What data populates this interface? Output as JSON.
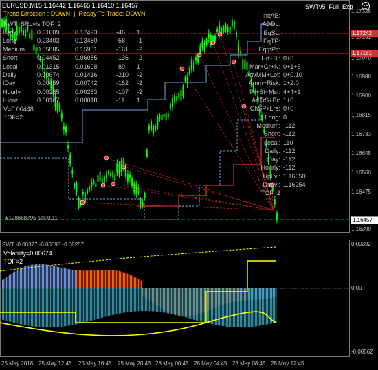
{
  "chart_header": {
    "symbol": "EURUSD,M15",
    "ohlc": "1.16442 1.16465 1.16410 1.16457",
    "expert_name": "SWTv5_Full_Exp",
    "smiley_icon": "smiley-icon"
  },
  "trend_status": {
    "text": "Trend Direction : DOWN  |  Ready To Trade: DOWN",
    "color": "#ffd700"
  },
  "indicator_table": {
    "title": "SWT_SRLvls TOF=2",
    "rows": [
      {
        "label": "Basic",
        "v1": "0.31009",
        "v2": "0.17493",
        "v3": "-46",
        "v4": "1"
      },
      {
        "label": "Long",
        "v1": "0.23403",
        "v2": "0.13480",
        "v3": "-58",
        "v4": "-1"
      },
      {
        "label": "Medium",
        "v1": "0.05885",
        "v2": "0.15951",
        "v3": "-161",
        "v4": "-2"
      },
      {
        "label": "Short",
        "v1": "0.04452",
        "v2": "0.06085",
        "v3": "-136",
        "v4": "-2"
      },
      {
        "label": "Local",
        "v1": "0.01315",
        "v2": "0.01608",
        "v3": "-89",
        "v4": "1"
      },
      {
        "label": "Daily",
        "v1": "0.00674",
        "v2": "0.01416",
        "v3": "-210",
        "v4": "-2"
      },
      {
        "label": "IDay",
        "v1": "0.00459",
        "v2": "0.00742",
        "v3": "-162",
        "v4": "-2"
      },
      {
        "label": "Hourly",
        "v1": "0.00285",
        "v2": "0.00283",
        "v3": "-107",
        "v4": "-2"
      },
      {
        "label": "IHour",
        "v1": "0.00107",
        "v2": "0.00018",
        "v3": "-11",
        "v4": "1"
      }
    ],
    "volatility_line": "V=0.00448",
    "tof_line": "TOF=2"
  },
  "status_panel": [
    {
      "label": "InitAB:",
      "value": ""
    },
    {
      "label": "ADDL:",
      "value": ""
    },
    {
      "label": "EqSL:",
      "value": ""
    },
    {
      "label": "EqTP:",
      "value": ""
    },
    {
      "label": "EqtpPc:",
      "value": ""
    },
    {
      "label": "Hrt+Bl:",
      "value": "0+0"
    },
    {
      "label": "Mar+Gr+N:",
      "value": "0+1+5"
    },
    {
      "label": "AdvMM+Lot:",
      "value": "0+0.10"
    },
    {
      "label": "Amm+Risk:",
      "value": "1+2.0"
    },
    {
      "label": "Pr+St+Mst:",
      "value": "4+4+1"
    },
    {
      "label": "AdTrS+Br:",
      "value": "1+0"
    },
    {
      "label": "ChSP+Lre:",
      "value": "0+0"
    },
    {
      "label": "Long:",
      "value": "0"
    },
    {
      "label": "Medium:",
      "value": "-112"
    },
    {
      "label": "Short:",
      "value": "-112"
    },
    {
      "label": "Local:",
      "value": "110"
    },
    {
      "label": "Daily:",
      "value": "-112"
    },
    {
      "label": "IDay:",
      "value": "-112"
    },
    {
      "label": "Hourly:",
      "value": "-112"
    },
    {
      "label": "UpLvl:",
      "value": "1.16650"
    },
    {
      "label": "DnLvl:",
      "value": "1.16254"
    },
    {
      "label": "TOF=2",
      "value": ""
    }
  ],
  "order_label": "#128688795 sell 0.11",
  "price_axis": {
    "labels": [
      "1.17325",
      "1.17161",
      "1.17070",
      "1.16988",
      "1.16900",
      "1.16815",
      "1.16733",
      "1.16645",
      "1.16560",
      "1.16475",
      "1.16390"
    ],
    "highlight_red_1": "1.17242",
    "highlight_red_2": "1.17161",
    "current_price": "1.16457"
  },
  "subwindow": {
    "header": "SWT -0.00377 -0.00093 -0.00257",
    "volatility": "Volatility=0.00674",
    "tof": "TOF=2",
    "axis_labels": [
      "0.00392",
      "0.00",
      "-0.00562"
    ]
  },
  "time_axis": [
    "25 May 2018",
    "25 May 12:45",
    "25 May 16:45",
    "25 May 20:45",
    "28 May 00:45",
    "28 May 04:45",
    "28 May 08:45",
    "28 May 12:45"
  ],
  "colors": {
    "bull_candle": "#00ff00",
    "bear_candle": "#00ff00",
    "support_line": "#7aa3e5",
    "resistance_line": "#ff4040",
    "highlight_red": "#d23232",
    "current_price_box": "#000000",
    "histogram_blue": "#6a8fd6",
    "histogram_orange": "#ff5a00",
    "yellow_line": "#ffff00"
  }
}
